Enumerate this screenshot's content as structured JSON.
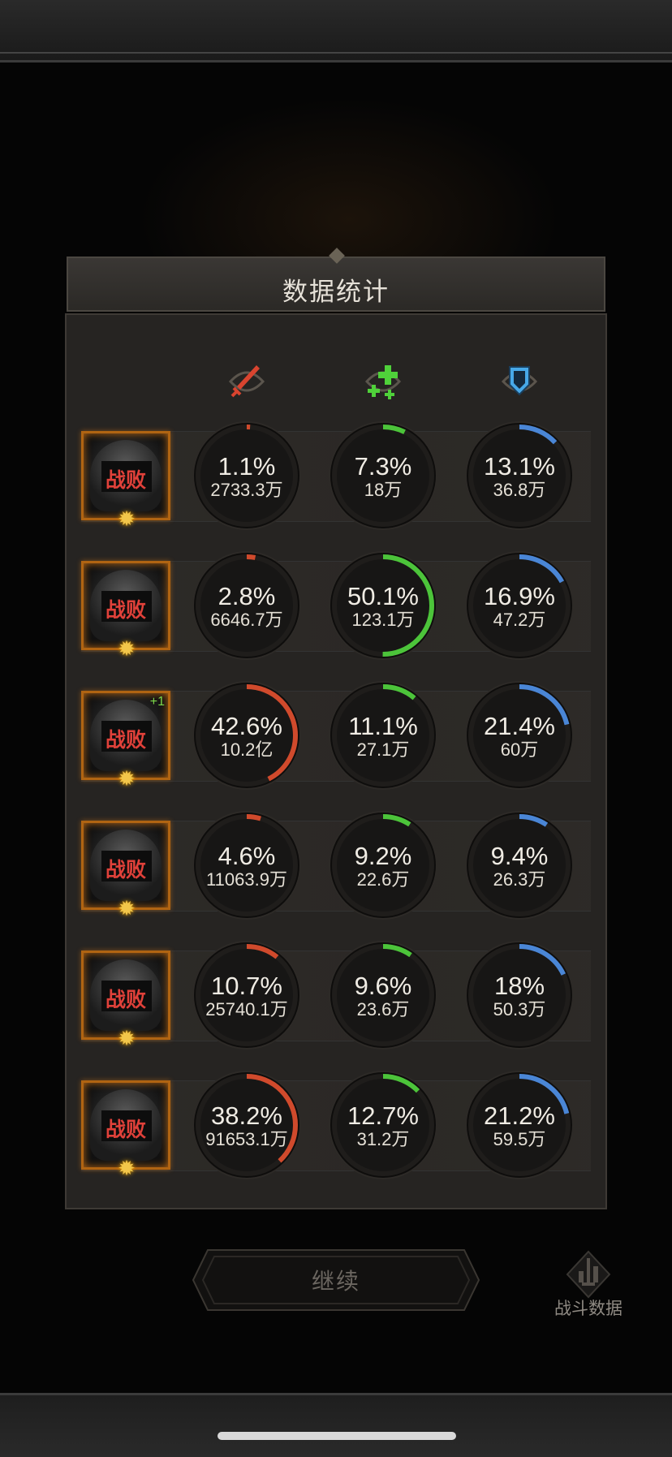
{
  "panel": {
    "title": "数据统计"
  },
  "columns": [
    {
      "icon": "sword-icon",
      "color": "#d9442f"
    },
    {
      "icon": "heal-cross-icon",
      "color": "#4fd13a"
    },
    {
      "icon": "shield-icon",
      "color": "#47a8e8"
    }
  ],
  "colors": {
    "damage": "#d04a2c",
    "heal": "#4cc43a",
    "tank": "#4a86d6",
    "defeat": "#e0413a",
    "ring_bg": "#171615"
  },
  "rows": [
    {
      "status": "战败",
      "stars": "✹",
      "level_badge": "",
      "damage": {
        "pct": "1.1%",
        "amount": "2733.3万",
        "value": 1.1
      },
      "heal": {
        "pct": "7.3%",
        "amount": "18万",
        "value": 7.3
      },
      "tank": {
        "pct": "13.1%",
        "amount": "36.8万",
        "value": 13.1
      }
    },
    {
      "status": "战败",
      "stars": "✹",
      "level_badge": "",
      "damage": {
        "pct": "2.8%",
        "amount": "6646.7万",
        "value": 2.8
      },
      "heal": {
        "pct": "50.1%",
        "amount": "123.1万",
        "value": 50.1
      },
      "tank": {
        "pct": "16.9%",
        "amount": "47.2万",
        "value": 16.9
      }
    },
    {
      "status": "战败",
      "stars": "✹",
      "level_badge": "+1",
      "damage": {
        "pct": "42.6%",
        "amount": "10.2亿",
        "value": 42.6
      },
      "heal": {
        "pct": "11.1%",
        "amount": "27.1万",
        "value": 11.1
      },
      "tank": {
        "pct": "21.4%",
        "amount": "60万",
        "value": 21.4
      }
    },
    {
      "status": "战败",
      "stars": "✹",
      "level_badge": "",
      "damage": {
        "pct": "4.6%",
        "amount": "11063.9万",
        "value": 4.6
      },
      "heal": {
        "pct": "9.2%",
        "amount": "22.6万",
        "value": 9.2
      },
      "tank": {
        "pct": "9.4%",
        "amount": "26.3万",
        "value": 9.4
      }
    },
    {
      "status": "战败",
      "stars": "✹",
      "level_badge": "",
      "damage": {
        "pct": "10.7%",
        "amount": "25740.1万",
        "value": 10.7
      },
      "heal": {
        "pct": "9.6%",
        "amount": "23.6万",
        "value": 9.6
      },
      "tank": {
        "pct": "18%",
        "amount": "50.3万",
        "value": 18
      }
    },
    {
      "status": "战败",
      "stars": "✹",
      "level_badge": "",
      "damage": {
        "pct": "38.2%",
        "amount": "91653.1万",
        "value": 38.2
      },
      "heal": {
        "pct": "12.7%",
        "amount": "31.2万",
        "value": 12.7
      },
      "tank": {
        "pct": "21.2%",
        "amount": "59.5万",
        "value": 21.2
      }
    }
  ],
  "buttons": {
    "continue_label": "继续",
    "battle_data_label": "战斗数据"
  }
}
